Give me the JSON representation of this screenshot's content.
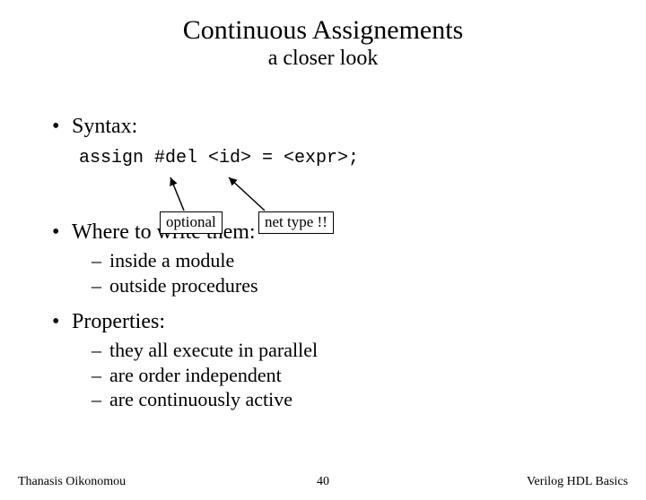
{
  "title": "Continuous Assignements",
  "subtitle": "a closer look",
  "b1": "Syntax:",
  "syntax_line": "assign #del <id> = <expr>;",
  "callout_optional": "optional",
  "callout_nettype": "net type !!",
  "b2": "Where to write them:",
  "where": {
    "a": "inside a module",
    "b": "outside procedures"
  },
  "b3": "Properties:",
  "props": {
    "a": "they all execute in parallel",
    "b": "are order independent",
    "c": "are continuously active"
  },
  "footer": {
    "left": "Thanasis Oikonomou",
    "center": "40",
    "right": "Verilog HDL Basics"
  },
  "glyph": {
    "bullet": "•",
    "dash": "–"
  }
}
